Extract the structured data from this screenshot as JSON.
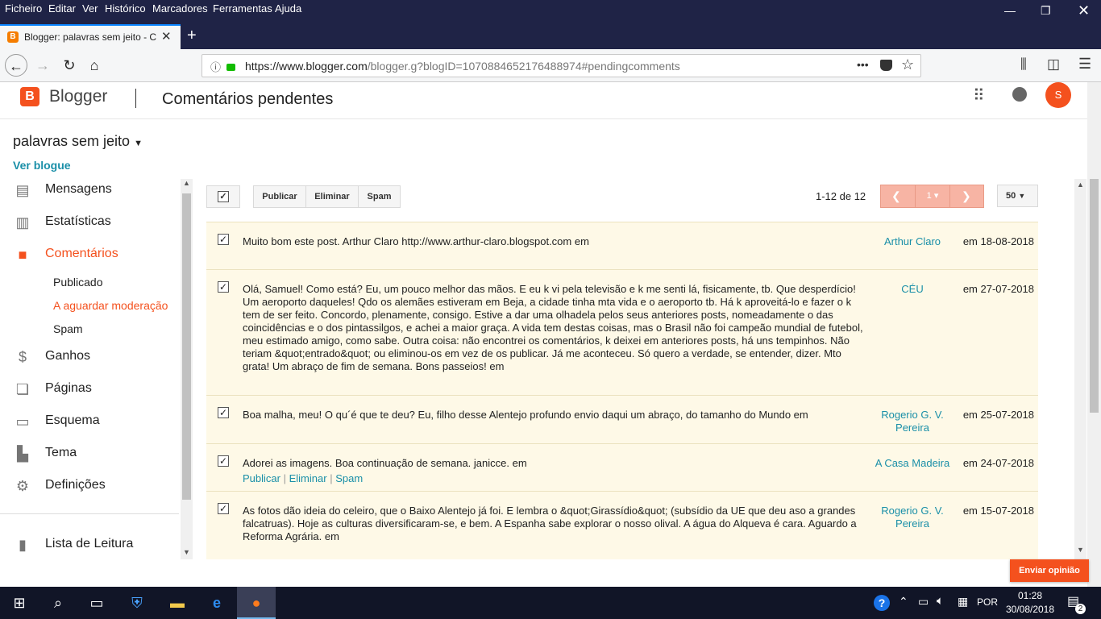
{
  "menubar": {
    "items": [
      "Ficheiro",
      "Editar",
      "Ver",
      "Histórico",
      "Marcadores",
      "Ferramentas",
      "Ajuda"
    ]
  },
  "browser": {
    "tab_title": "Blogger: palavras sem jeito - Co",
    "url_host": "https://www.blogger.com",
    "url_path": "/blogger.g?blogID=1070884652176488974#pendingcomments",
    "more": "•••"
  },
  "header": {
    "brand": "Blogger",
    "page_title": "Comentários pendentes",
    "avatar": "S"
  },
  "sidebar": {
    "blog_name": "palavras sem jeito",
    "view_blog": "Ver blogue",
    "items": [
      {
        "label": "Mensagens",
        "icon": "posts-icon"
      },
      {
        "label": "Estatísticas",
        "icon": "stats-icon"
      },
      {
        "label": "Comentários",
        "icon": "comments-icon"
      },
      {
        "label": "Ganhos",
        "icon": "dollar-icon"
      },
      {
        "label": "Páginas",
        "icon": "pages-icon"
      },
      {
        "label": "Esquema",
        "icon": "layout-icon"
      },
      {
        "label": "Tema",
        "icon": "paint-roller-icon"
      },
      {
        "label": "Definições",
        "icon": "gear-icon"
      }
    ],
    "sub_items": [
      "Publicado",
      "A aguardar moderação",
      "Spam"
    ],
    "reading_list": "Lista de Leitura",
    "accent_color": "#f4511e"
  },
  "toolbar": {
    "publish": "Publicar",
    "delete": "Eliminar",
    "spam": "Spam",
    "count": "1-12 de 12",
    "page": "1",
    "per_page": "50"
  },
  "comments": [
    {
      "text": "Muito bom este post. Arthur Claro http://www.arthur-claro.blogspot.com em",
      "author": "Arthur Claro",
      "date": "em 18-08-2018"
    },
    {
      "text": "Olá, Samuel! Como está? Eu, um pouco melhor das mãos. E eu k vi pela televisão e k me senti lá, fisicamente, tb. Que desperdício! Um aeroporto daqueles! Qdo os alemães estiveram em Beja, a cidade tinha mta vida e o aeroporto tb. Há k aproveitá-lo e fazer o k tem de ser feito. Concordo, plenamente, consigo. Estive a dar uma olhadela pelos seus anteriores posts, nomeadamente o das coincidências e o dos pintassilgos, e achei a maior graça. A vida tem destas coisas, mas o Brasil não foi campeão mundial de futebol, meu estimado amigo, como sabe. Outra coisa: não encontrei os comentários, k deixei em anteriores posts, há uns tempinhos. Não teriam &quot;entrado&quot; ou eliminou-os em vez de os publicar. Já me aconteceu. Só quero a verdade, se entender, dizer. Mto grata! Um abraço de fim de semana. Bons passeios! em",
      "author": "CÉU",
      "date": "em 27-07-2018"
    },
    {
      "text": "Boa malha, meu! O qu´é que te deu? Eu, filho desse Alentejo profundo envio daqui um abraço, do tamanho do Mundo em",
      "author": "Rogerio G. V. Pereira",
      "date": "em 25-07-2018"
    },
    {
      "text": "Adorei as imagens. Boa continuação de semana. janicce. em",
      "author": "A Casa Madeira",
      "date": "em 24-07-2018"
    },
    {
      "text": "As fotos dão ideia do celeiro, que o Baixo Alentejo já foi. E lembra o &quot;Girassídio&quot; (subsídio da UE que deu aso a grandes falcatruas). Hoje as culturas diversificaram-se, e bem. A Espanha sabe explorar o nosso olival. A água do Alqueva é cara. Aguardo a Reforma Agrária. em",
      "author": "Rogerio G. V. Pereira",
      "date": "em 15-07-2018"
    }
  ],
  "row_actions": {
    "publish": "Publicar",
    "delete": "Eliminar",
    "spam": "Spam",
    "sep": "|"
  },
  "feedback": "Enviar opinião",
  "taskbar": {
    "lang": "POR",
    "time": "01:28",
    "date": "30/08/2018",
    "notif": "2"
  }
}
